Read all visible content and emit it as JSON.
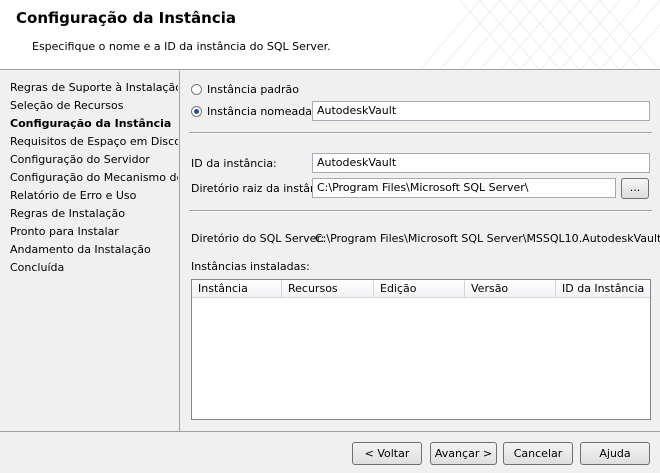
{
  "header": {
    "title": "Configuração da Instância",
    "subtitle": "Especifique o nome e a ID da instância do SQL Server."
  },
  "sidebar": {
    "items": [
      {
        "label": "Regras de Suporte à Instalação",
        "active": false
      },
      {
        "label": "Seleção de Recursos",
        "active": false
      },
      {
        "label": "Configuração da Instância",
        "active": true
      },
      {
        "label": "Requisitos de Espaço em Disco",
        "active": false
      },
      {
        "label": "Configuração do Servidor",
        "active": false
      },
      {
        "label": "Configuração do Mecanismo de B...",
        "active": false
      },
      {
        "label": "Relatório de Erro e Uso",
        "active": false
      },
      {
        "label": "Regras de Instalação",
        "active": false
      },
      {
        "label": "Pronto para Instalar",
        "active": false
      },
      {
        "label": "Andamento da Instalação",
        "active": false
      },
      {
        "label": "Concluída",
        "active": false
      }
    ]
  },
  "instance": {
    "default_label": "Instância padrão",
    "default_checked": false,
    "named_label": "Instância nomeada:",
    "named_checked": true,
    "named_value": "AutodeskVault",
    "id_label": "ID da instância:",
    "id_value": "AutodeskVault",
    "root_label": "Diretório raiz da instância:",
    "root_value": "C:\\Program Files\\Microsoft SQL Server\\",
    "browse_label": "...",
    "sqldir_label": "Diretório do SQL Server:",
    "sqldir_value": "C:\\Program Files\\Microsoft SQL Server\\MSSQL10.AutodeskVault",
    "installed_label": "Instâncias instaladas:"
  },
  "grid": {
    "columns": [
      "Instância",
      "Recursos",
      "Edição",
      "Versão",
      "ID da Instância"
    ],
    "rows": []
  },
  "footer": {
    "back": "< Voltar",
    "next": "Avançar >",
    "cancel": "Cancelar",
    "help": "Ajuda"
  }
}
